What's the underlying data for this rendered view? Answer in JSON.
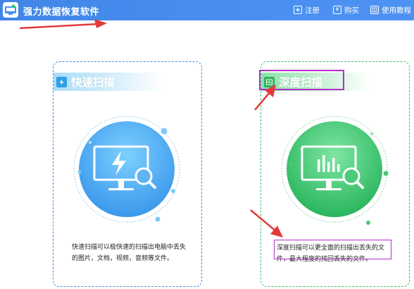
{
  "app": {
    "title": "强力数据恢复软件"
  },
  "top_menu": {
    "register": {
      "label": "注册",
      "icon": "register-icon"
    },
    "buy": {
      "label": "购买",
      "icon": "yen-icon",
      "glyph": "¥"
    },
    "help": {
      "label": "使用教程",
      "icon": "book-icon"
    }
  },
  "cards": {
    "quick": {
      "title": "快速扫描",
      "icon": "lightning-icon",
      "graphic_icon": "monitor-lightning-magnifier-icon",
      "description": "快速扫描可以极快速的扫描出电脑中丢失的图片，文档，视频，音频等文件。",
      "color": "#3a9ff0"
    },
    "deep": {
      "title": "深度扫描",
      "icon": "deep-scan-icon",
      "graphic_icon": "monitor-barchart-magnifier-icon",
      "description": "深度扫描可以更全面的扫描出丢失的文件，最大程度的找回丢失的文件。",
      "color": "#34c46a"
    }
  },
  "colors": {
    "titlebar": "#4a8ff0",
    "quick_accent": "#3a9ff0",
    "deep_accent": "#34c46a",
    "annotation_arrow": "#e23b3b",
    "annotation_box": "#b030c8"
  }
}
